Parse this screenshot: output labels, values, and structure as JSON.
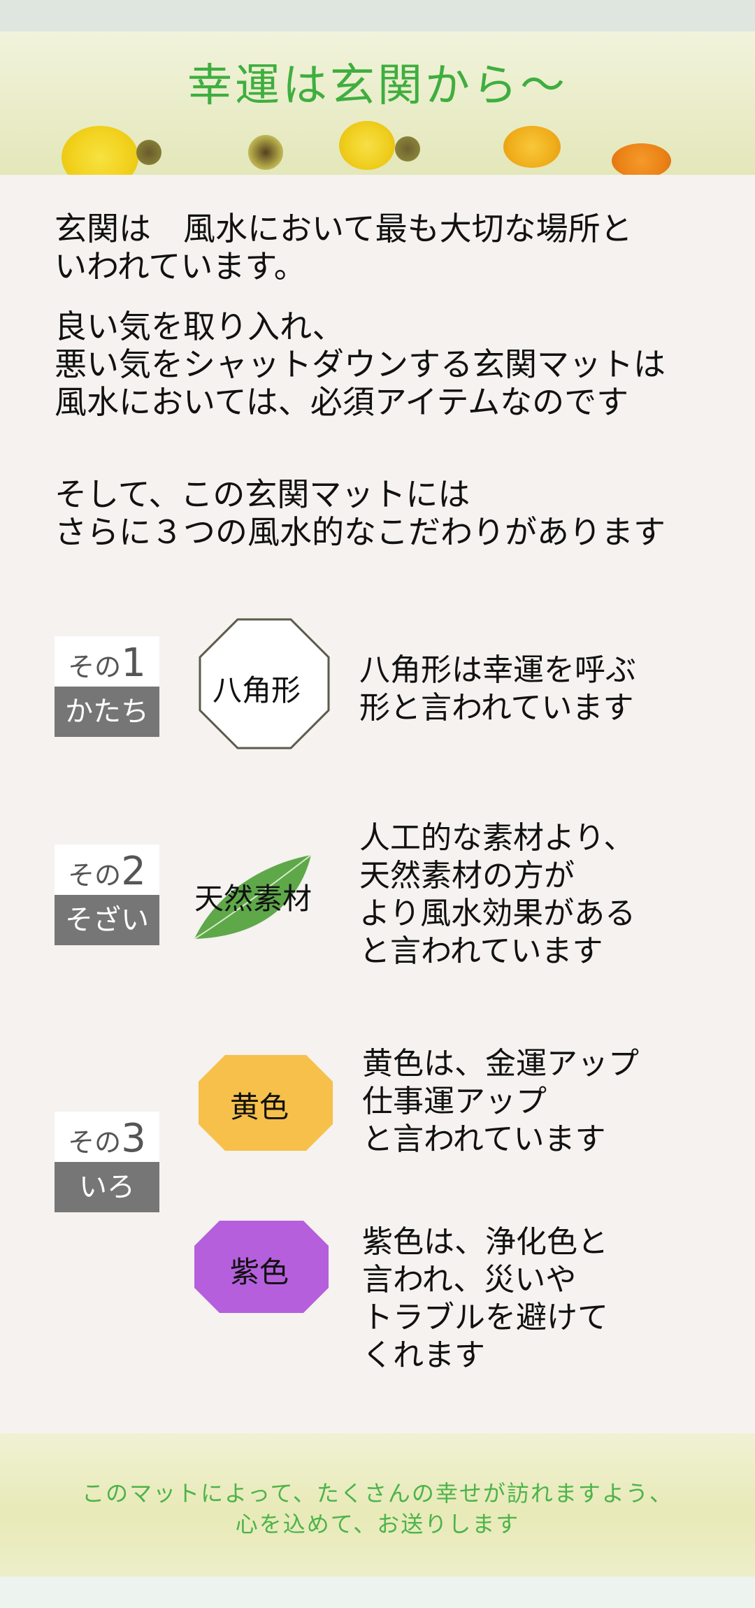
{
  "header": {
    "title": "幸運は玄関から〜"
  },
  "intro": {
    "p1": "玄関は　風水において最も大切な場所と\nいわれています。",
    "p2": "良い気を取り入れ、\n悪い気をシャットダウンする玄関マットは\n風水においては、必須アイテムなのです",
    "p3": "そして、この玄関マットには\nさらに３つの風水的なこだわりがあります"
  },
  "features": [
    {
      "label_prefix": "その",
      "label_num": "1",
      "label_sub": "かたち",
      "visual_label": "八角形",
      "text": "八角形は幸運を呼ぶ\n形と言われています"
    },
    {
      "label_prefix": "その",
      "label_num": "2",
      "label_sub": "そざい",
      "visual_label": "天然素材",
      "text": "人工的な素材より、\n天然素材の方が\nより風水効果がある\nと言われています"
    },
    {
      "label_prefix": "その",
      "label_num": "3",
      "label_sub": "いろ",
      "colors": [
        {
          "name": "黄色",
          "text": "黄色は、金運アップ\n仕事運アップ\nと言われています",
          "hex": "#f6c04a"
        },
        {
          "name": "紫色",
          "text": "紫色は、浄化色と\n言われ、災いや\nトラブルを避けて\nくれます",
          "hex": "#b65fdc"
        }
      ]
    }
  ],
  "footer": {
    "line1": "このマットによって、たくさんの幸せが訪れますよう、",
    "line2": "心を込めて、お送りします"
  },
  "colors": {
    "title_green": "#3fae3f",
    "label_gray": "#767676",
    "footer_green": "#4db34a"
  }
}
